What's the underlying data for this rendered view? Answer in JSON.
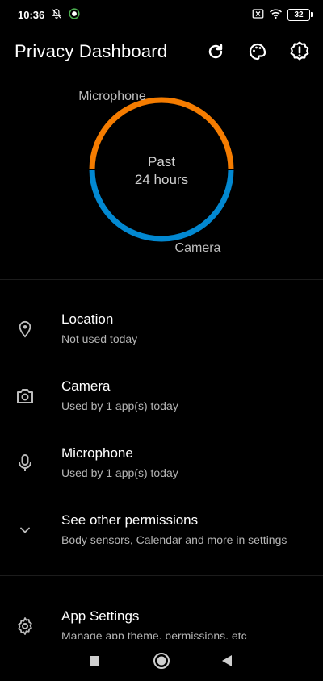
{
  "status_bar": {
    "time": "10:36",
    "battery": "32",
    "icons": [
      "notifications-off-icon",
      "sync-app-icon",
      "sim-off-icon",
      "wifi-icon",
      "battery-icon"
    ]
  },
  "header": {
    "title": "Privacy Dashboard",
    "actions": [
      "refresh-icon",
      "palette-icon",
      "alert-badge-icon"
    ]
  },
  "chart_data": {
    "type": "pie",
    "center_label_line1": "Past",
    "center_label_line2": "24 hours",
    "categories": [
      "Microphone",
      "Camera"
    ],
    "values": [
      50,
      50
    ],
    "colors": [
      "#F57C00",
      "#0288D1"
    ]
  },
  "permissions": [
    {
      "title": "Location",
      "subtitle": "Not used today",
      "icon": "location-pin-icon"
    },
    {
      "title": "Camera",
      "subtitle": "Used by 1 app(s) today",
      "icon": "camera-icon"
    },
    {
      "title": "Microphone",
      "subtitle": "Used by 1 app(s) today",
      "icon": "microphone-icon"
    },
    {
      "title": "See other permissions",
      "subtitle": "Body sensors, Calendar and more in settings",
      "icon": "chevron-down-icon"
    }
  ],
  "app_settings": {
    "title": "App Settings",
    "subtitle": "Manage app theme, permissions, etc",
    "icon": "gear-icon"
  },
  "nav_bar": {
    "buttons": [
      "recents-square-icon",
      "home-circle-icon",
      "back-triangle-icon"
    ]
  }
}
